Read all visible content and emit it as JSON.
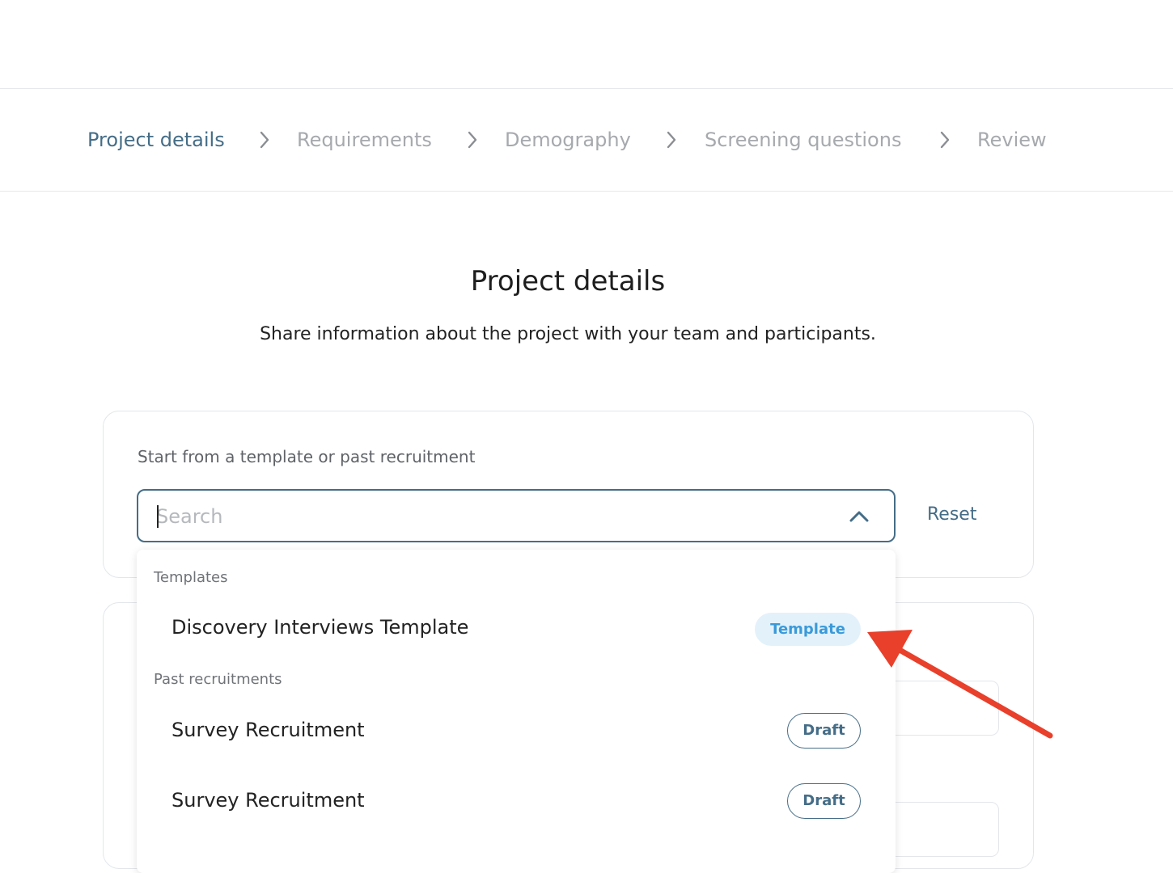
{
  "stepper": {
    "steps": [
      {
        "label": "Project details",
        "active": true
      },
      {
        "label": "Requirements",
        "active": false
      },
      {
        "label": "Demography",
        "active": false
      },
      {
        "label": "Screening questions",
        "active": false
      },
      {
        "label": "Review",
        "active": false
      }
    ]
  },
  "header": {
    "title": "Project details",
    "subtitle": "Share information about the project with your team and participants."
  },
  "template_picker": {
    "label": "Start from a template or past recruitment",
    "search": {
      "value": "",
      "placeholder": "Search"
    },
    "reset_label": "Reset"
  },
  "dropdown": {
    "groups": [
      {
        "label": "Templates",
        "items": [
          {
            "label": "Discovery Interviews Template",
            "badge": "Template"
          }
        ]
      },
      {
        "label": "Past recruitments",
        "items": [
          {
            "label": "Survey Recruitment",
            "badge": "Draft"
          },
          {
            "label": "Survey Recruitment",
            "badge": "Draft"
          }
        ]
      }
    ]
  },
  "colors": {
    "accent": "#456d87",
    "muted_step": "#a6a9ad",
    "template_badge_bg": "#e3f1fb",
    "template_badge_text": "#3a9ad9",
    "annotation_arrow": "#e8402b"
  },
  "icons": {
    "step_separator": "chevron-right-icon",
    "search_toggle": "chevron-up-icon",
    "annotation": "arrow-icon"
  }
}
